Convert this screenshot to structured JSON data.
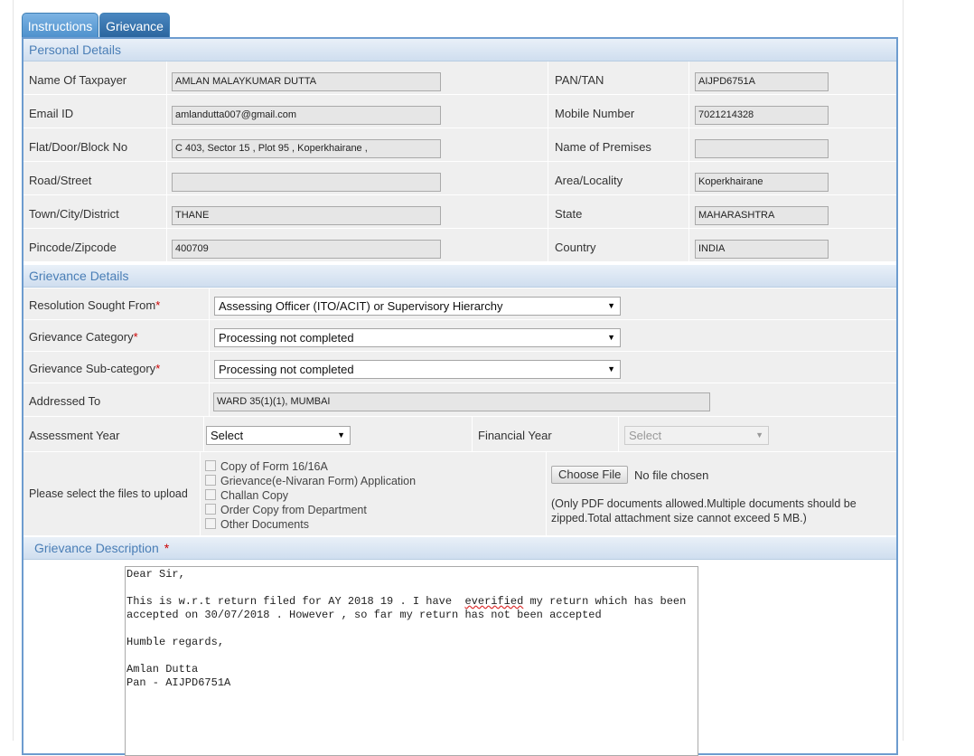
{
  "tabs": {
    "instructions": "Instructions",
    "grievance": "Grievance"
  },
  "personal": {
    "title": "Personal Details",
    "name_label": "Name Of Taxpayer",
    "name": "AMLAN MALAYKUMAR DUTTA",
    "pan_label": "PAN/TAN",
    "pan": "AIJPD6751A",
    "email_label": "Email ID",
    "email": "amlandutta007@gmail.com",
    "mobile_label": "Mobile Number",
    "mobile": "7021214328",
    "flat_label": "Flat/Door/Block No",
    "flat": "C 403, Sector 15 , Plot 95 , Koperkhairane ,",
    "premises_label": "Name of Premises",
    "premises": "",
    "road_label": "Road/Street",
    "road": "",
    "area_label": "Area/Locality",
    "area": "Koperkhairane",
    "town_label": "Town/City/District",
    "town": "THANE",
    "state_label": "State",
    "state": "MAHARASHTRA",
    "pin_label": "Pincode/Zipcode",
    "pin": "400709",
    "country_label": "Country",
    "country": "INDIA"
  },
  "grievance": {
    "title": "Grievance Details",
    "resolution_label": "Resolution Sought From",
    "resolution": "Assessing Officer (ITO/ACIT) or Supervisory Hierarchy",
    "category_label": "Grievance Category",
    "category": "Processing not completed",
    "subcategory_label": "Grievance Sub-category",
    "subcategory": "Processing not completed",
    "addressed_label": "Addressed To",
    "addressed": "WARD 35(1)(1), MUMBAI",
    "ay_label": "Assessment Year",
    "ay": "Select",
    "fy_label": "Financial Year",
    "fy": "Select",
    "upload_label": "Please select the files to upload",
    "files": [
      "Copy of Form 16/16A",
      "Grievance(e-Nivaran Form) Application",
      "Challan Copy",
      "Order Copy from Department",
      "Other Documents"
    ],
    "choose_btn": "Choose File",
    "no_file": "No file chosen",
    "note_line1": "(Only PDF documents allowed.Multiple documents should be",
    "note_line2": "zipped.Total attachment size cannot exceed 5 MB.)"
  },
  "description": {
    "title": "Grievance Description",
    "l1": "Dear Sir,",
    "l2a": "This is w.r.t return filed for AY 2018 19 . I have  ",
    "l2b": "everified",
    "l2c": " my return which has been",
    "l3": "accepted on 30/07/2018 . However , so far my return has not been accepted",
    "l4": "Humble regards,",
    "l5": "Amlan Dutta",
    "l6": "Pan - AIJPD6751A"
  },
  "required_mark": "*",
  "icons": {
    "dropdown": "chevron-down-icon",
    "checkbox": "checkbox-icon"
  }
}
